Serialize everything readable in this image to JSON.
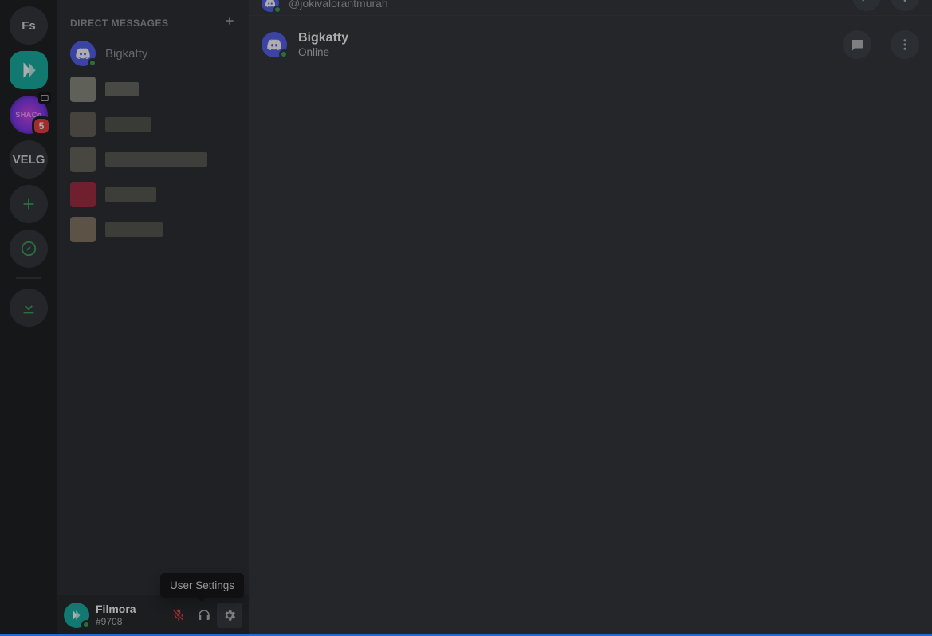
{
  "servers": {
    "home_initials": "Fs",
    "shaco_label": "SHACo",
    "shaco_badge": "5",
    "velg_label": "VELG"
  },
  "sidebar": {
    "dm_header": "DIRECT MESSAGES",
    "dm": {
      "name": "Bigkatty"
    }
  },
  "user_panel": {
    "name": "Filmora",
    "tag": "#9708",
    "tooltip": "User Settings"
  },
  "top_prev": {
    "handle": "@jokivalorantmurah"
  },
  "profile": {
    "name": "Bigkatty",
    "status": "Online"
  }
}
